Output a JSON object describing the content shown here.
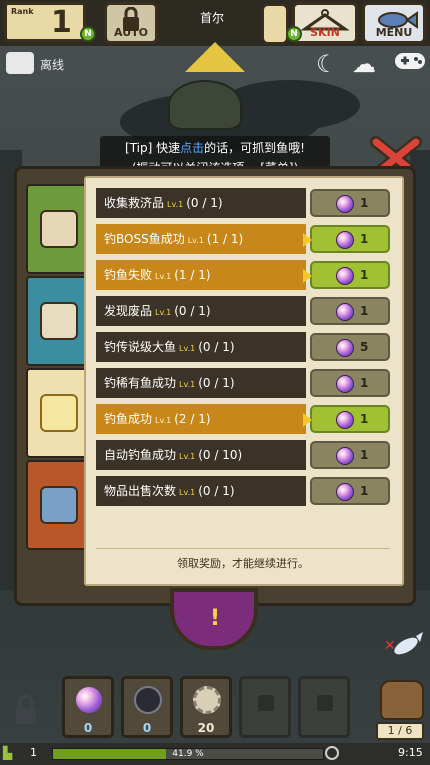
{
  "top": {
    "rank_label": "Rank",
    "rank_value": "1",
    "auto_label": "AUTO",
    "location": "首尔",
    "skin_label": "SKIN",
    "menu_label": "MENU",
    "n_badge": "N"
  },
  "status": {
    "offline": "离线"
  },
  "tip": {
    "line1_prefix": "[Tip] 快速",
    "line1_highlight": "点击",
    "line1_suffix": "的话，可抓到鱼哦!",
    "line2": "(振动可以关闭该选项。 [菜单])"
  },
  "achievements": [
    {
      "label": "收集救济品",
      "level": "Lv.1",
      "progress": "(0 / 1)",
      "reward": "1",
      "done": false
    },
    {
      "label": "钓BOSS鱼成功",
      "level": "Lv.1",
      "progress": "(1 / 1)",
      "reward": "1",
      "done": true
    },
    {
      "label": "钓鱼失败",
      "level": "Lv.1",
      "progress": "(1 / 1)",
      "reward": "1",
      "done": true
    },
    {
      "label": "发现废品",
      "level": "Lv.1",
      "progress": "(0 / 1)",
      "reward": "1",
      "done": false
    },
    {
      "label": "钓传说级大鱼",
      "level": "Lv.1",
      "progress": "(0 / 1)",
      "reward": "5",
      "done": false
    },
    {
      "label": "钓稀有鱼成功",
      "level": "Lv.1",
      "progress": "(0 / 1)",
      "reward": "1",
      "done": false
    },
    {
      "label": "钓鱼成功",
      "level": "Lv.1",
      "progress": "(2 / 1)",
      "reward": "1",
      "done": true
    },
    {
      "label": "自动钓鱼成功",
      "level": "Lv.1",
      "progress": "(0 / 10)",
      "reward": "1",
      "done": false
    },
    {
      "label": "物品出售次数",
      "level": "Lv.1",
      "progress": "(0 / 1)",
      "reward": "1",
      "done": false
    }
  ],
  "notice": "领取奖励，才能继续进行。",
  "purple_button": "!",
  "inventory": [
    {
      "icon": "orb-icon",
      "count": "0"
    },
    {
      "icon": "web-icon",
      "count": "0"
    },
    {
      "icon": "gear-icon",
      "count": "20"
    },
    {
      "icon": "lock-icon",
      "count": ""
    },
    {
      "icon": "lock-icon",
      "count": ""
    }
  ],
  "page_indicator": "1 / 6",
  "bottom_status": {
    "level": "1",
    "xp_percent_text": "41.9 %",
    "xp_fraction": 0.419,
    "time": "9:15"
  },
  "colors": {
    "done_row": "#c8871a",
    "pending_row": "#3b3327",
    "done_reward": "#a2c034",
    "pending_reward": "#8a8460",
    "tip_highlight": "#5aa7ff"
  }
}
